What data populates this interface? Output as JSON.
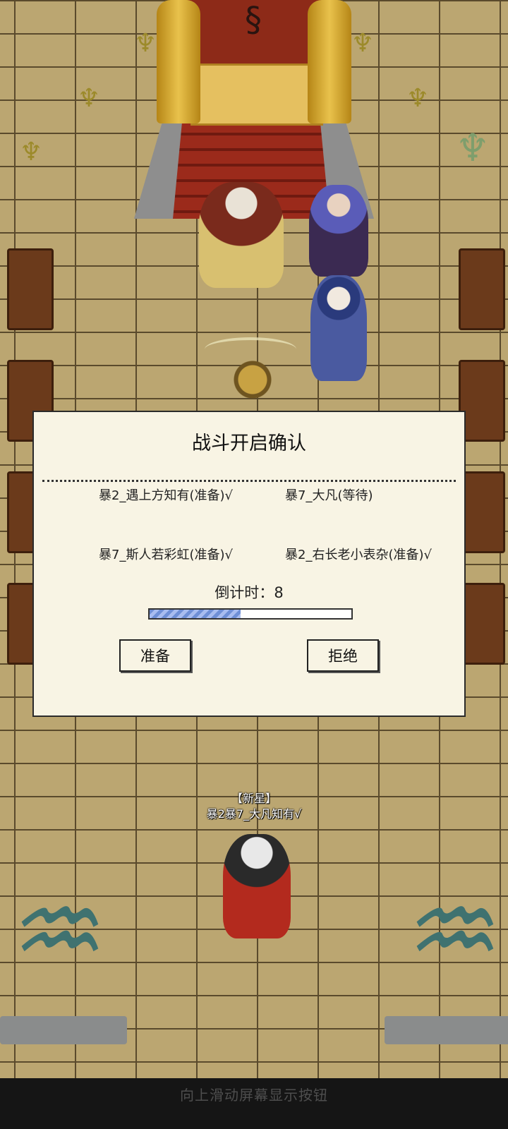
{
  "dialog": {
    "title": "战斗开启确认",
    "members": [
      {
        "text": "暴2_遇上方知有(准备)√"
      },
      {
        "text": "暴7_大凡(等待)"
      },
      {
        "text": "暴7_斯人若彩虹(准备)√"
      },
      {
        "text": "暴2_右长老小表杂(准备)√"
      }
    ],
    "countdown_label": "倒计时：",
    "countdown_value": "8",
    "progress_fraction": 0.45,
    "ready_button": "准备",
    "reject_button": "拒绝"
  },
  "player": {
    "title": "【新星】",
    "name": "暴2暴7_大凡知有√"
  },
  "system": {
    "swipe_hint": "向上滑动屏幕显示按钮"
  },
  "colors": {
    "wall": "#bba671",
    "mortar": "#5a4a2c",
    "dialog_bg": "#f8f4e4",
    "progress_fill": "#6f8fd6",
    "bottom_bar": "#151515"
  }
}
